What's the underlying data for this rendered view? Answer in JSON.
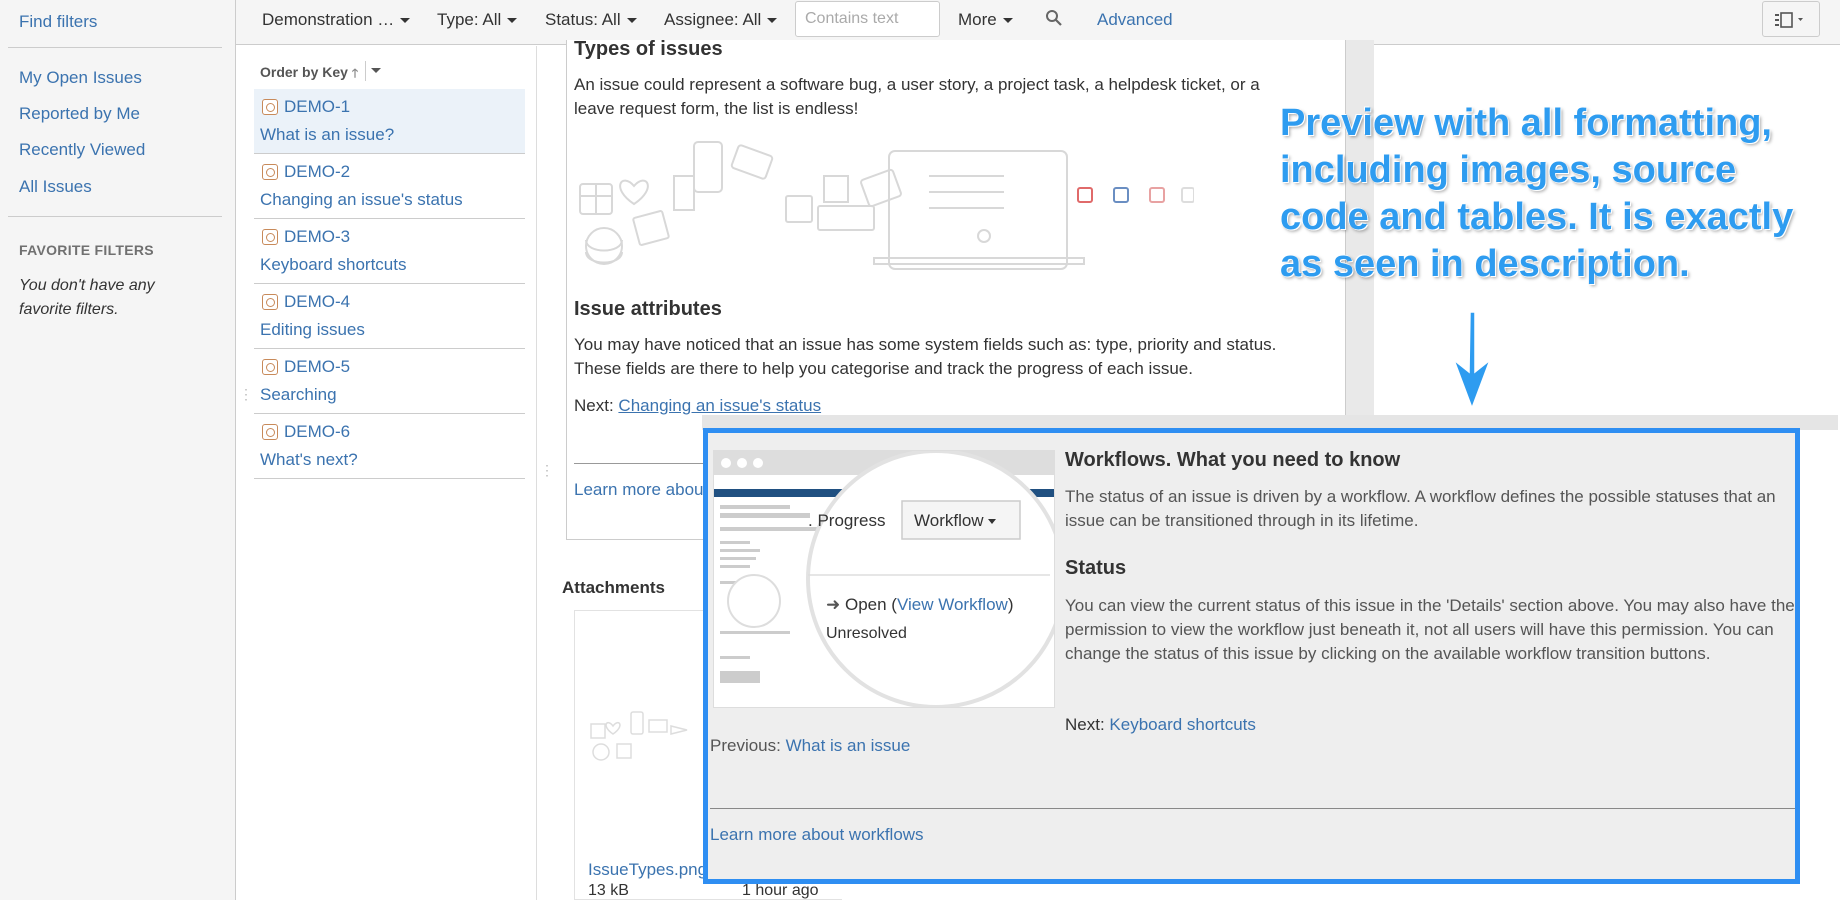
{
  "sidebar": {
    "find_filters": "Find filters",
    "items": [
      "My Open Issues",
      "Reported by Me",
      "Recently Viewed",
      "All Issues"
    ],
    "favorite_heading": "FAVORITE FILTERS",
    "favorite_empty": "You don't have any favorite filters."
  },
  "toolbar": {
    "project": "Demonstration …",
    "type": "Type: All",
    "status": "Status: All",
    "assignee": "Assignee: All",
    "search_placeholder": "Contains text",
    "more": "More",
    "advanced": "Advanced",
    "icons": {
      "search": "magnifier-icon",
      "view": "list-view-icon"
    }
  },
  "issue_list": {
    "order_label": "Order by Key",
    "issues": [
      {
        "key": "DEMO-1",
        "summary": "What is an issue?"
      },
      {
        "key": "DEMO-2",
        "summary": "Changing an issue's status"
      },
      {
        "key": "DEMO-3",
        "summary": "Keyboard shortcuts"
      },
      {
        "key": "DEMO-4",
        "summary": "Editing issues"
      },
      {
        "key": "DEMO-5",
        "summary": "Searching"
      },
      {
        "key": "DEMO-6",
        "summary": "What's next?"
      }
    ]
  },
  "detail": {
    "types_heading": "Types of issues",
    "types_text": "An issue could represent a software bug, a user story, a project task, a helpdesk ticket, or a leave request form, the list is endless!",
    "attributes_heading": "Issue attributes",
    "attributes_text": "You may have noticed that an issue has some system fields such as: type, priority and status. These fields are there to help you categorise and track the progress of each issue.",
    "next_prefix": "Next:",
    "next_link": "Changing an issue's status",
    "learn_more": "Learn more abou",
    "attachments_heading": "Attachments",
    "attachment": {
      "name": "IssueTypes.png",
      "size": "13 kB",
      "time": "1 hour ago"
    }
  },
  "annotation": {
    "text": "Preview with all formatting, including images, source code and tables. It is exactly as seen in description."
  },
  "preview": {
    "title": "Workflows. What you need to know",
    "intro": "The status of an issue is driven by a workflow. A workflow defines the possible statuses that an issue can be transitioned through in its lifetime.",
    "status_heading": "Status",
    "status_text": "You can view the current status of this issue in the 'Details' section above. You may also have the permission to view the workflow just beneath it, not all users will have this permission. You can change the status of this issue by clicking on the available workflow transition buttons.",
    "next_prefix": "Next:",
    "next_link": "Keyboard shortcuts",
    "prev_prefix": "Previous:",
    "prev_link": "What is an issue",
    "learn_more": "Learn more about workflows",
    "thumbnail": {
      "progress": ". Progress",
      "workflow": "Workflow",
      "open": "Open",
      "view_workflow": "View Workflow",
      "unresolved": "Unresolved"
    }
  },
  "colors": {
    "accent": "#2e8ef2",
    "link": "#3b73af",
    "annotation": "#2e9cf0"
  }
}
